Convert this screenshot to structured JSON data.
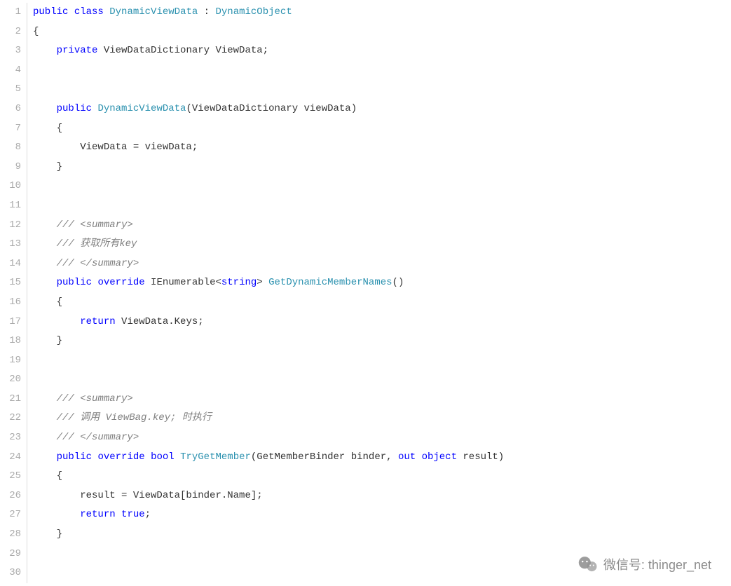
{
  "lineCount": 30,
  "code": {
    "1": [
      {
        "class": "kw",
        "text": "public"
      },
      {
        "class": "txt",
        "text": " "
      },
      {
        "class": "kw",
        "text": "class"
      },
      {
        "class": "txt",
        "text": " "
      },
      {
        "class": "type",
        "text": "DynamicViewData"
      },
      {
        "class": "txt",
        "text": " : "
      },
      {
        "class": "type",
        "text": "DynamicObject"
      }
    ],
    "2": [
      {
        "class": "txt",
        "text": "{"
      }
    ],
    "3": [
      {
        "class": "txt",
        "text": "    "
      },
      {
        "class": "kw",
        "text": "private"
      },
      {
        "class": "txt",
        "text": " ViewDataDictionary ViewData;"
      }
    ],
    "4": [],
    "5": [],
    "6": [
      {
        "class": "txt",
        "text": "    "
      },
      {
        "class": "kw",
        "text": "public"
      },
      {
        "class": "txt",
        "text": " "
      },
      {
        "class": "type",
        "text": "DynamicViewData"
      },
      {
        "class": "txt",
        "text": "(ViewDataDictionary viewData)"
      }
    ],
    "7": [
      {
        "class": "txt",
        "text": "    {"
      }
    ],
    "8": [
      {
        "class": "txt",
        "text": "        ViewData = viewData;"
      }
    ],
    "9": [
      {
        "class": "txt",
        "text": "    }"
      }
    ],
    "10": [],
    "11": [],
    "12": [
      {
        "class": "txt",
        "text": "    "
      },
      {
        "class": "comment-text",
        "text": "/// "
      },
      {
        "class": "comment-text",
        "text": "<summary>"
      }
    ],
    "13": [
      {
        "class": "txt",
        "text": "    "
      },
      {
        "class": "comment-text",
        "text": "/// 获取所有key"
      }
    ],
    "14": [
      {
        "class": "txt",
        "text": "    "
      },
      {
        "class": "comment-text",
        "text": "/// "
      },
      {
        "class": "comment-text",
        "text": "</summary>"
      }
    ],
    "15": [
      {
        "class": "txt",
        "text": "    "
      },
      {
        "class": "kw",
        "text": "public"
      },
      {
        "class": "txt",
        "text": " "
      },
      {
        "class": "kw",
        "text": "override"
      },
      {
        "class": "txt",
        "text": " IEnumerable<"
      },
      {
        "class": "kw",
        "text": "string"
      },
      {
        "class": "txt",
        "text": "> "
      },
      {
        "class": "method",
        "text": "GetDynamicMemberNames"
      },
      {
        "class": "txt",
        "text": "()"
      }
    ],
    "16": [
      {
        "class": "txt",
        "text": "    {"
      }
    ],
    "17": [
      {
        "class": "txt",
        "text": "        "
      },
      {
        "class": "kw",
        "text": "return"
      },
      {
        "class": "txt",
        "text": " ViewData.Keys;"
      }
    ],
    "18": [
      {
        "class": "txt",
        "text": "    }"
      }
    ],
    "19": [],
    "20": [],
    "21": [
      {
        "class": "txt",
        "text": "    "
      },
      {
        "class": "comment-text",
        "text": "/// "
      },
      {
        "class": "comment-text",
        "text": "<summary>"
      }
    ],
    "22": [
      {
        "class": "txt",
        "text": "    "
      },
      {
        "class": "comment-text",
        "text": "/// 调用 ViewBag.key; 时执行"
      }
    ],
    "23": [
      {
        "class": "txt",
        "text": "    "
      },
      {
        "class": "comment-text",
        "text": "/// "
      },
      {
        "class": "comment-text",
        "text": "</summary>"
      }
    ],
    "24": [
      {
        "class": "txt",
        "text": "    "
      },
      {
        "class": "kw",
        "text": "public"
      },
      {
        "class": "txt",
        "text": " "
      },
      {
        "class": "kw",
        "text": "override"
      },
      {
        "class": "txt",
        "text": " "
      },
      {
        "class": "kw",
        "text": "bool"
      },
      {
        "class": "txt",
        "text": " "
      },
      {
        "class": "method",
        "text": "TryGetMember"
      },
      {
        "class": "txt",
        "text": "(GetMemberBinder binder, "
      },
      {
        "class": "kw",
        "text": "out"
      },
      {
        "class": "txt",
        "text": " "
      },
      {
        "class": "kw",
        "text": "object"
      },
      {
        "class": "txt",
        "text": " result)"
      }
    ],
    "25": [
      {
        "class": "txt",
        "text": "    {"
      }
    ],
    "26": [
      {
        "class": "txt",
        "text": "        result = ViewData[binder.Name];"
      }
    ],
    "27": [
      {
        "class": "txt",
        "text": "        "
      },
      {
        "class": "kw",
        "text": "return"
      },
      {
        "class": "txt",
        "text": " "
      },
      {
        "class": "kw",
        "text": "true"
      },
      {
        "class": "txt",
        "text": ";"
      }
    ],
    "28": [
      {
        "class": "txt",
        "text": "    }"
      }
    ],
    "29": [],
    "30": []
  },
  "watermark": {
    "label": "微信号",
    "value": "thinger_net"
  }
}
